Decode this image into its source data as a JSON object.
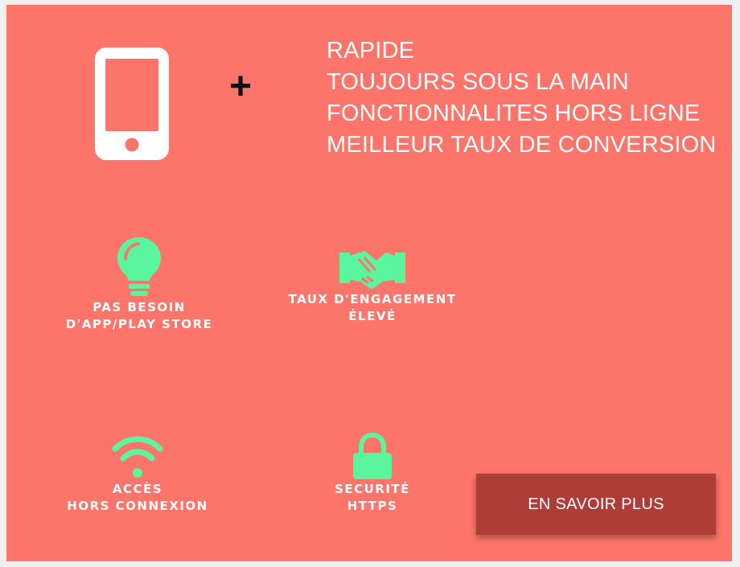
{
  "colors": {
    "background": "#fd756a",
    "icon_accent": "#5af59c",
    "text": "#ffffff",
    "cta_background": "#ad3d36"
  },
  "hero": {
    "icon": "smartphone-icon",
    "plus": "+",
    "benefits": [
      "RAPIDE",
      "TOUJOURS SOUS LA MAIN",
      "FONCTIONNALITES HORS LIGNE",
      "MEILLEUR TAUX DE CONVERSION"
    ]
  },
  "features": [
    {
      "icon": "lightbulb-icon",
      "line1": "PAS BESOIN",
      "line2": "D'APP/PLAY STORE"
    },
    {
      "icon": "handshake-icon",
      "line1": "TAUX D'ENGAGEMENT",
      "line2": "ÉLEVÉ"
    },
    {
      "icon": "wifi-icon",
      "line1": "ACCÈS",
      "line2": "HORS CONNEXION"
    },
    {
      "icon": "lock-icon",
      "line1": "SECURITÉ",
      "line2": "HTTPS"
    }
  ],
  "cta": {
    "label": "EN SAVOIR PLUS"
  }
}
